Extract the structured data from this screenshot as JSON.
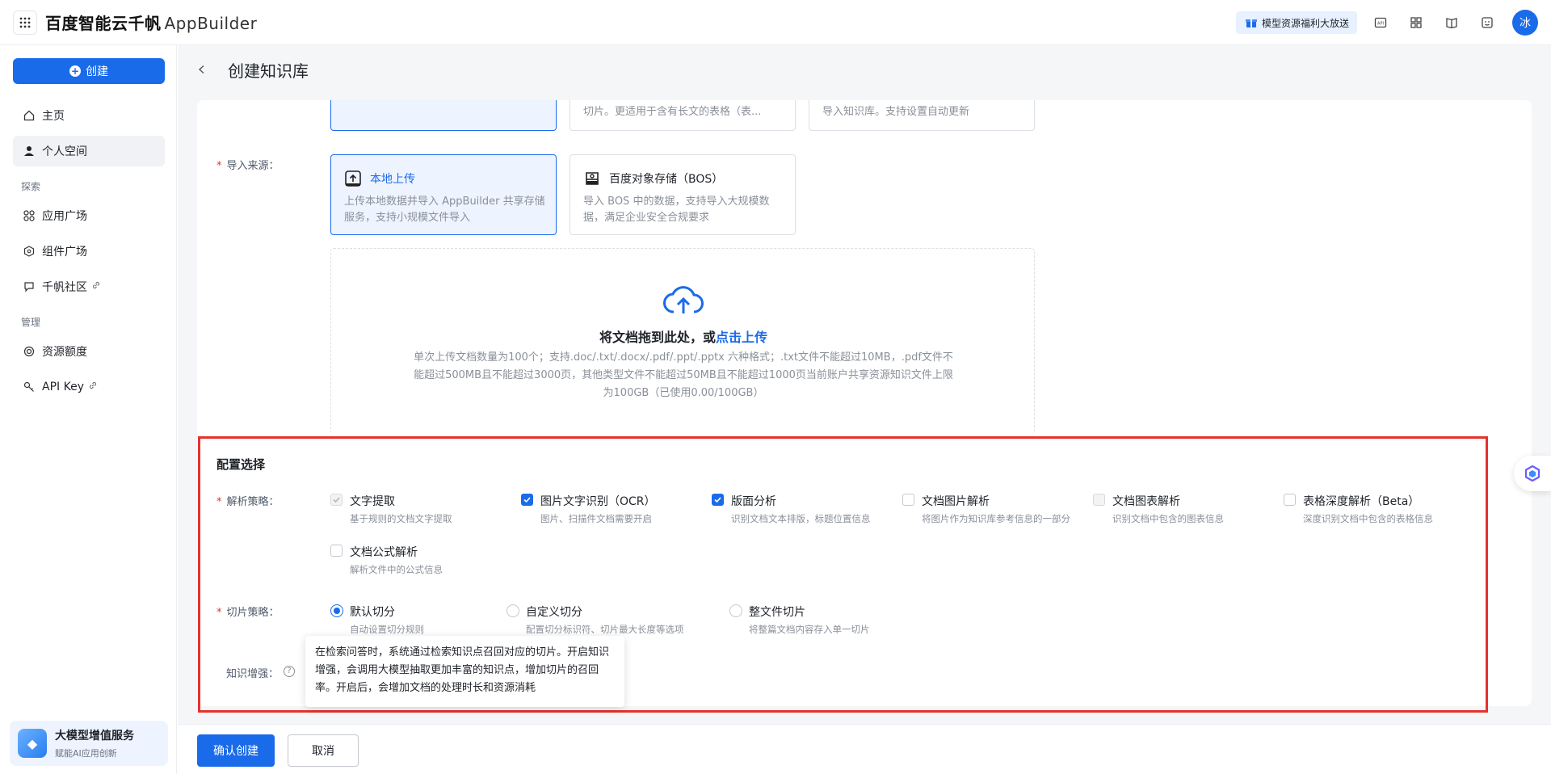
{
  "app": {
    "brand_cn": "百度智能云千帆",
    "brand_en": "AppBuilder",
    "promo": "模型资源福利大放送",
    "avatar_text": "冰"
  },
  "sidebar": {
    "create_label": "创建",
    "items": [
      {
        "label": "主页"
      },
      {
        "label": "个人空间"
      },
      {
        "label": "应用广场"
      },
      {
        "label": "组件广场"
      },
      {
        "label": "千帆社区"
      },
      {
        "label": "资源额度"
      },
      {
        "label": "API Key"
      }
    ],
    "section_explore": "探索",
    "section_manage": "管理",
    "promo_title": "大模型增值服务",
    "promo_sub": "赋能AI应用创新"
  },
  "page": {
    "title": "创建知识库"
  },
  "partial_cards": {
    "desc2": "切片。更适用于含有长文的表格（表...",
    "desc3": "导入知识库。支持设置自动更新"
  },
  "import_source": {
    "label": "导入来源：",
    "options": [
      {
        "title": "本地上传",
        "desc": "上传本地数据并导入 AppBuilder 共享存储服务，支持小规模文件导入"
      },
      {
        "title": "百度对象存储（BOS）",
        "desc": "导入 BOS 中的数据，支持导入大规模数据，满足企业安全合规要求"
      }
    ]
  },
  "upload": {
    "title_prefix": "将文档拖到此处，或",
    "title_link": "点击上传",
    "desc": "单次上传文档数量为100个；支持.doc/.txt/.docx/.pdf/.ppt/.pptx 六种格式；.txt文件不能超过10MB，.pdf文件不能超过500MB且不能超过3000页，其他类型文件不能超过50MB且不能超过1000页当前账户共享资源知识文件上限为100GB（已使用0.00/100GB）"
  },
  "config": {
    "title": "配置选择",
    "parse_label": "解析策略：",
    "parse_options": [
      {
        "label": "文字提取",
        "desc": "基于规则的文档文字提取",
        "state": "checked-disabled"
      },
      {
        "label": "图片文字识别（OCR）",
        "desc": "图片、扫描件文档需要开启",
        "state": "checked"
      },
      {
        "label": "版面分析",
        "desc": "识别文档文本排版，标题位置信息",
        "state": "checked"
      },
      {
        "label": "文档图片解析",
        "desc": "将图片作为知识库参考信息的一部分",
        "state": "unchecked"
      },
      {
        "label": "文档图表解析",
        "desc": "识别文档中包含的图表信息",
        "state": "disabled"
      },
      {
        "label": "表格深度解析（Beta）",
        "desc": "深度识别文档中包含的表格信息",
        "state": "unchecked"
      },
      {
        "label": "文档公式解析",
        "desc": "解析文件中的公式信息",
        "state": "unchecked"
      }
    ],
    "chunk_label": "切片策略：",
    "chunk_options": [
      {
        "label": "默认切分",
        "desc": "自动设置切分规则",
        "selected": true
      },
      {
        "label": "自定义切分",
        "desc": "配置切分标识符、切片最大长度等选项",
        "selected": false
      },
      {
        "label": "整文件切片",
        "desc": "将整篇文档内容存入单一切片",
        "selected": false
      }
    ],
    "enhance_label": "知识增强：",
    "tooltip": "在检索问答时，系统通过检索知识点召回对应的切片。开启知识增强，会调用大模型抽取更加丰富的知识点，增加切片的召回率。开启后，会增加文档的处理时长和资源消耗"
  },
  "footer": {
    "confirm": "确认创建",
    "cancel": "取消"
  },
  "colors": {
    "accent": "#1a6bea",
    "highlight": "#e5322d"
  }
}
